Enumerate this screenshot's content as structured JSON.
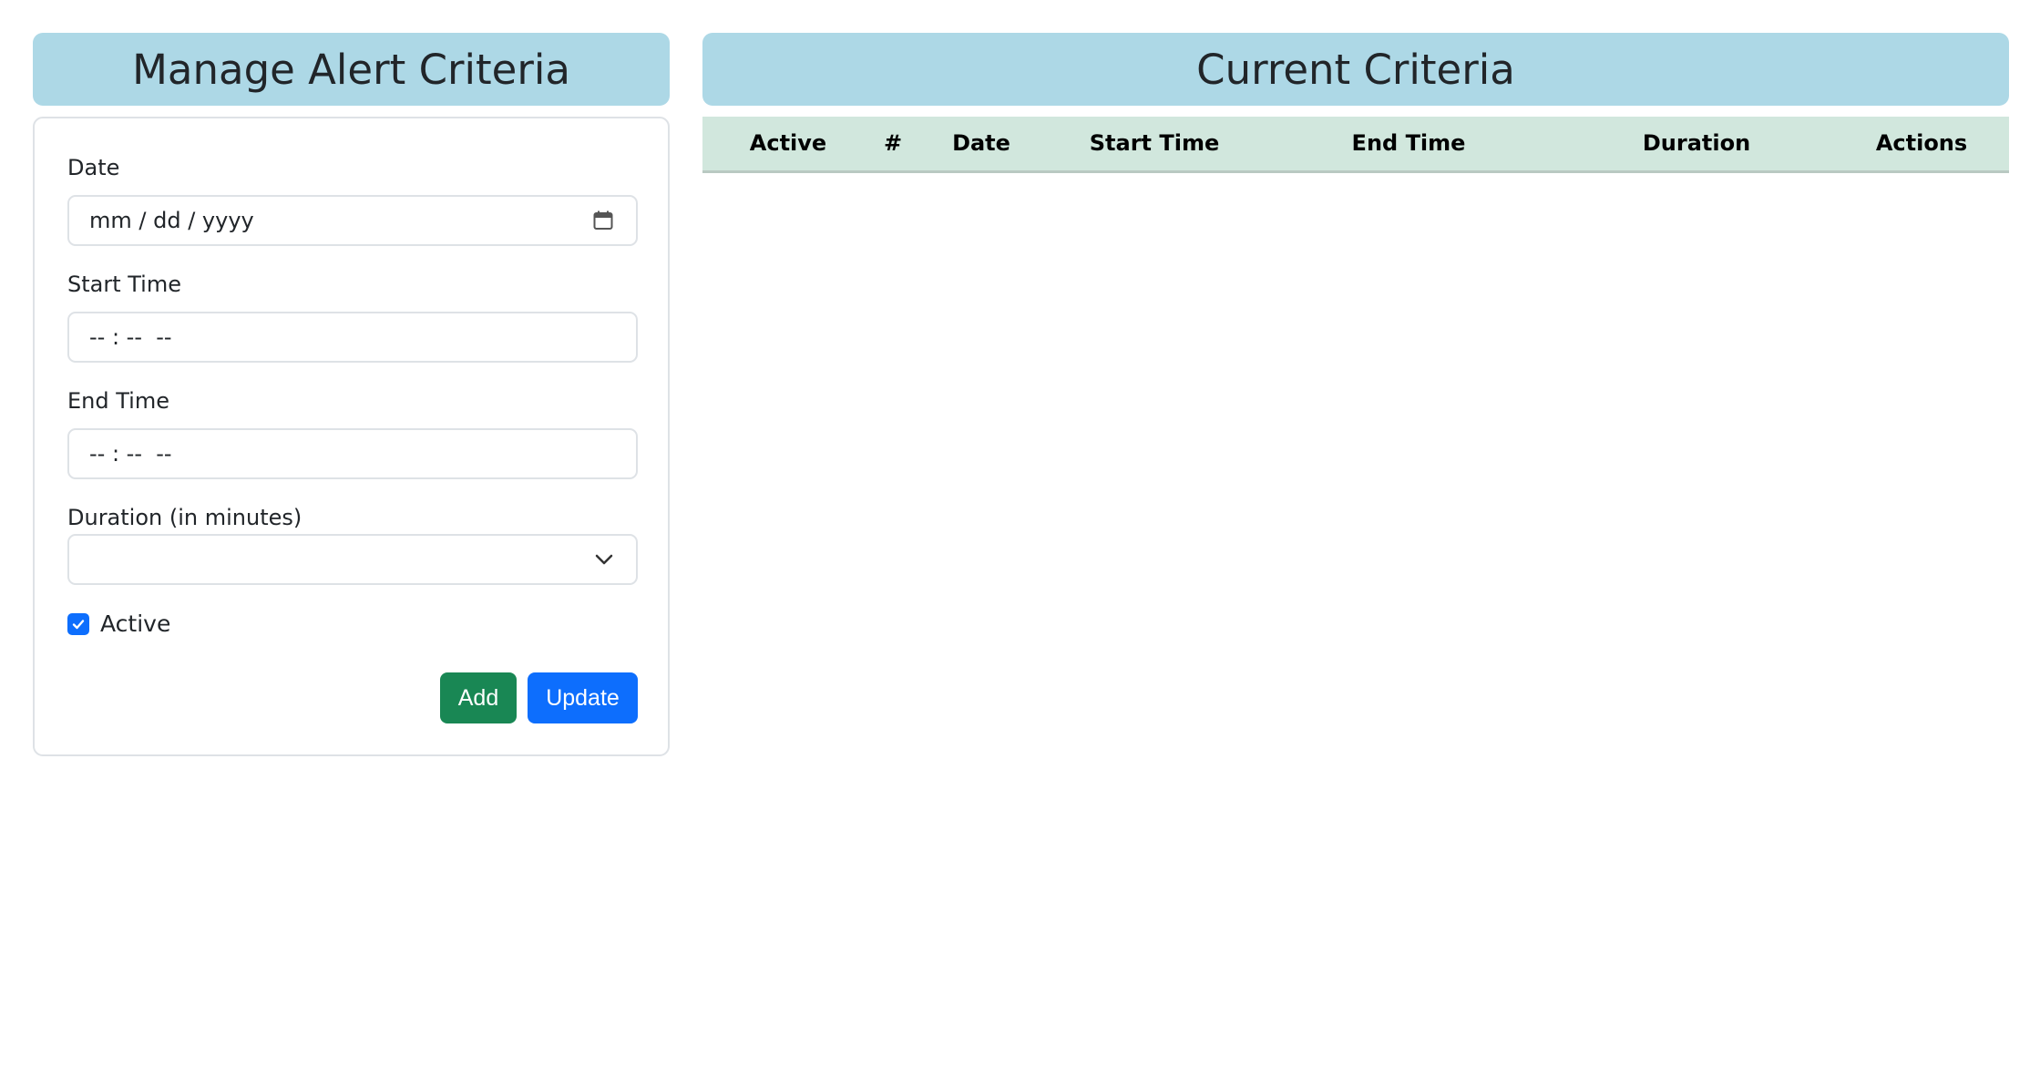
{
  "left_panel": {
    "title": "Manage Alert Criteria",
    "date": {
      "label": "Date",
      "placeholder": "mm / dd / yyyy",
      "icon": "calendar-icon"
    },
    "start_time": {
      "label": "Start Time",
      "placeholder": "-- : --  --"
    },
    "end_time": {
      "label": "End Time",
      "placeholder": "-- : --  --"
    },
    "duration": {
      "label": "Duration (in minutes)",
      "selected": "",
      "icon": "chevron-down-icon"
    },
    "active": {
      "label": "Active",
      "checked": true
    },
    "buttons": {
      "add": "Add",
      "update": "Update"
    }
  },
  "right_panel": {
    "title": "Current Criteria",
    "table": {
      "columns": [
        "Active",
        "#",
        "Date",
        "Start Time",
        "End Time",
        "Duration",
        "Actions"
      ],
      "rows": []
    }
  },
  "colors": {
    "header_bg": "#add8e6",
    "table_header_bg": "#d1e7dd",
    "add_button": "#198754",
    "update_button": "#0d6efd",
    "checkbox": "#0d6efd"
  }
}
